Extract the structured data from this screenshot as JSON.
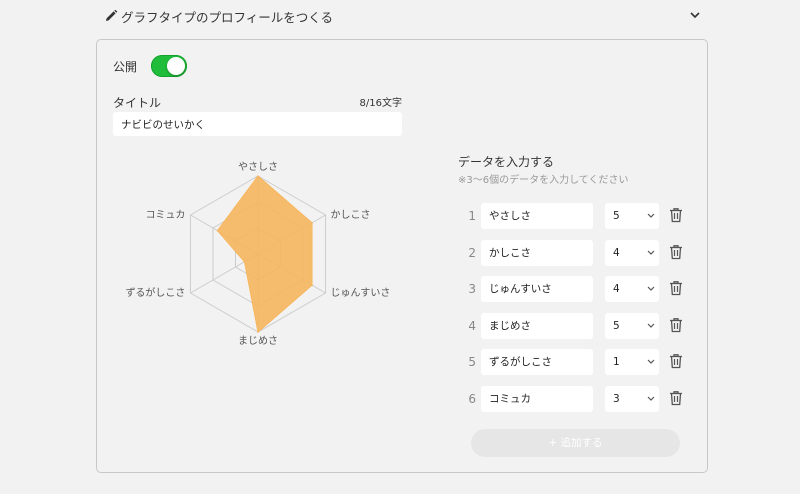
{
  "header": {
    "icon": "pencil-icon",
    "title": "グラフタイプのプロフィールをつくる",
    "expand_icon": "chevron-down-icon"
  },
  "form": {
    "public_label": "公開",
    "public_enabled": true,
    "title_label": "タイトル",
    "title_counter": "8/16文字",
    "title_value": "ナビビのせいかく"
  },
  "data_section": {
    "heading": "データを入力する",
    "hint": "※3〜6個のデータを入力してください",
    "rows": [
      {
        "index": "1",
        "label": "やさしさ",
        "value": "5"
      },
      {
        "index": "2",
        "label": "かしこさ",
        "value": "4"
      },
      {
        "index": "3",
        "label": "じゅんすいさ",
        "value": "4"
      },
      {
        "index": "4",
        "label": "まじめさ",
        "value": "5"
      },
      {
        "index": "5",
        "label": "ずるがしこさ",
        "value": "1"
      },
      {
        "index": "6",
        "label": "コミュカ",
        "value": "3"
      }
    ],
    "add_button": "+ 追加する"
  },
  "chart_data": {
    "type": "radar",
    "categories": [
      "やさしさ",
      "かしこさ",
      "じゅんすいさ",
      "まじめさ",
      "ずるがしこさ",
      "コミュカ"
    ],
    "values": [
      5,
      4,
      4,
      5,
      1,
      3
    ],
    "max": 5,
    "rings": 3,
    "fill_color": "#f6b65e",
    "grid_color": "#cccccc"
  },
  "colors": {
    "toggle_on": "#1fbd3a",
    "add_button_bg": "#e6e6e6"
  }
}
